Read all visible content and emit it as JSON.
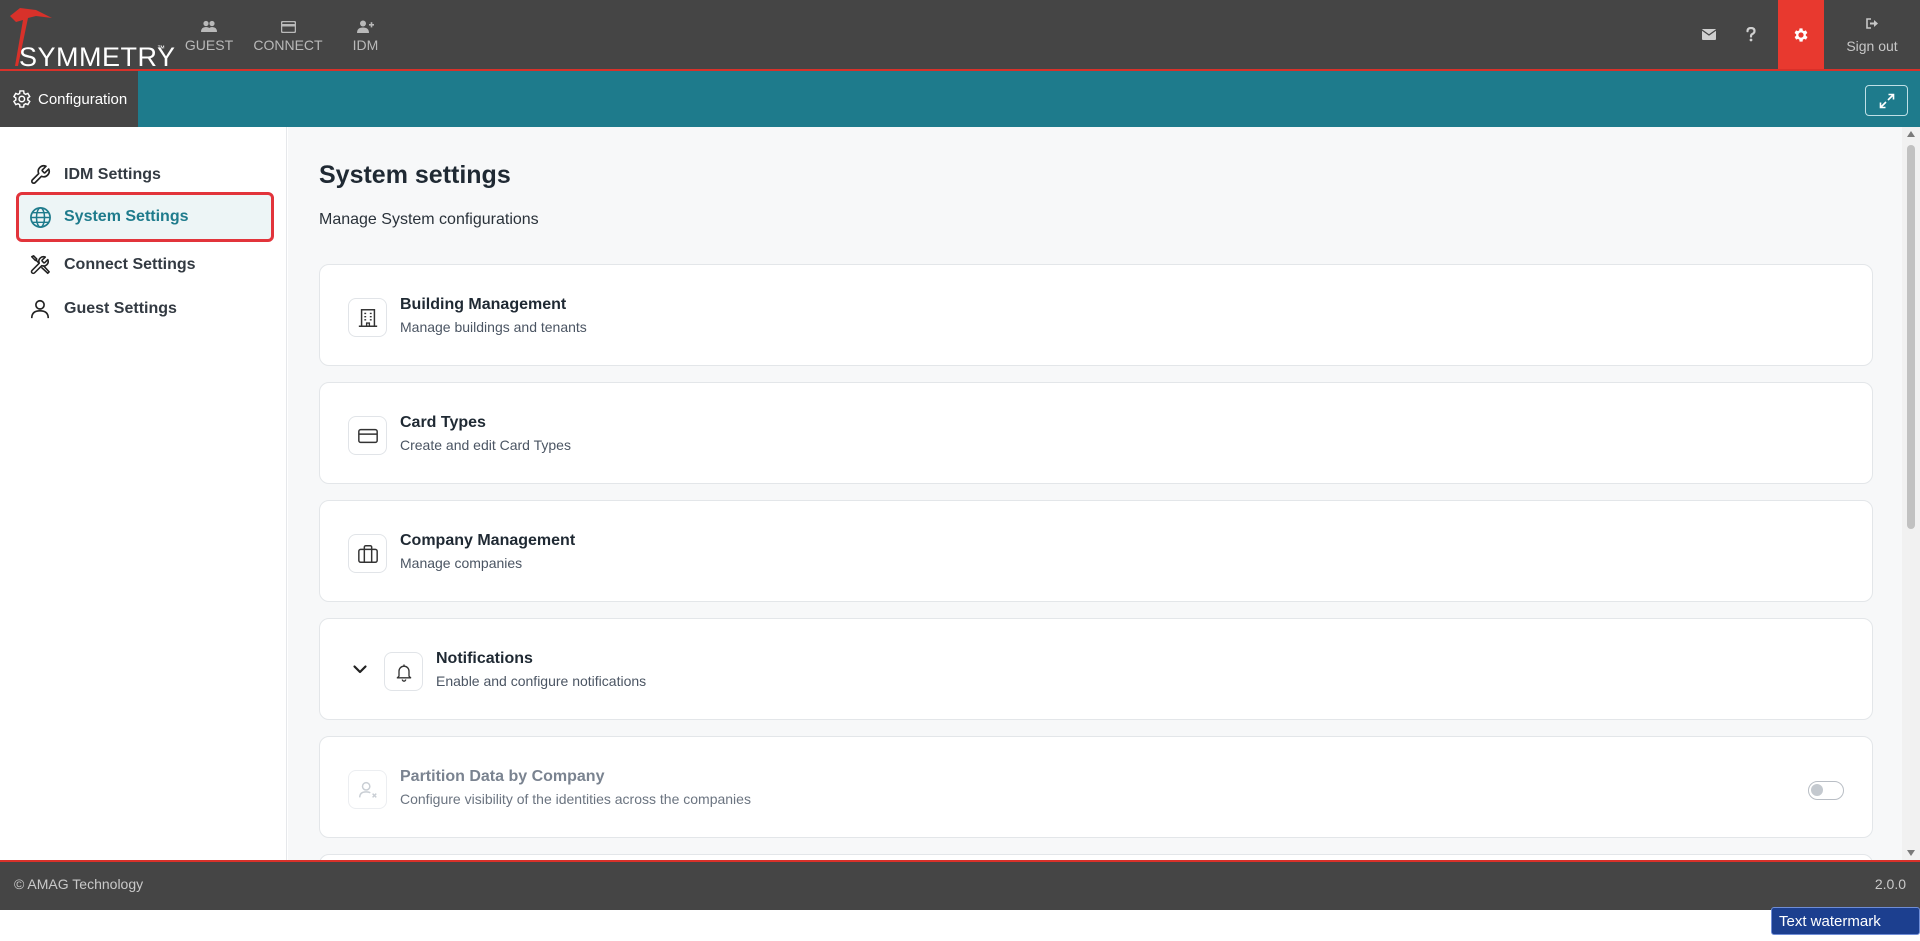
{
  "brand": {
    "name": "SYMMETRY",
    "trademark": "™"
  },
  "topnav": [
    {
      "label": "GUEST",
      "icon": "users-icon"
    },
    {
      "label": "CONNECT",
      "icon": "card-icon"
    },
    {
      "label": "IDM",
      "icon": "user-plus-icon"
    }
  ],
  "topright": {
    "signout_label": "Sign out"
  },
  "tealbar": {
    "tab_label": "Configuration"
  },
  "sidebar": {
    "items": [
      {
        "label": "IDM Settings",
        "icon": "wrench-icon"
      },
      {
        "label": "System Settings",
        "icon": "globe-icon",
        "active": true
      },
      {
        "label": "Connect Settings",
        "icon": "tools-icon"
      },
      {
        "label": "Guest Settings",
        "icon": "user-icon"
      }
    ]
  },
  "main": {
    "title": "System settings",
    "subtitle": "Manage System configurations",
    "cards": [
      {
        "title": "Building Management",
        "description": "Manage buildings and tenants",
        "icon": "building-icon"
      },
      {
        "title": "Card Types",
        "description": "Create and edit Card Types",
        "icon": "credit-card-icon"
      },
      {
        "title": "Company Management",
        "description": "Manage companies",
        "icon": "briefcase-icon"
      },
      {
        "title": "Notifications",
        "description": "Enable and configure notifications",
        "icon": "bell-icon",
        "expandable": true
      },
      {
        "title": "Partition Data by Company",
        "description": "Configure visibility of the identities across the companies",
        "icon": "user-x-icon",
        "toggle": false,
        "disabled": true
      }
    ]
  },
  "footer": {
    "copyright": "© AMAG Technology",
    "version": "2.0.0"
  },
  "watermark": "Text watermark",
  "colors": {
    "topbar": "#454545",
    "accent_red": "#e8392f",
    "teal": "#1e7b8c",
    "footer": "#454545"
  }
}
